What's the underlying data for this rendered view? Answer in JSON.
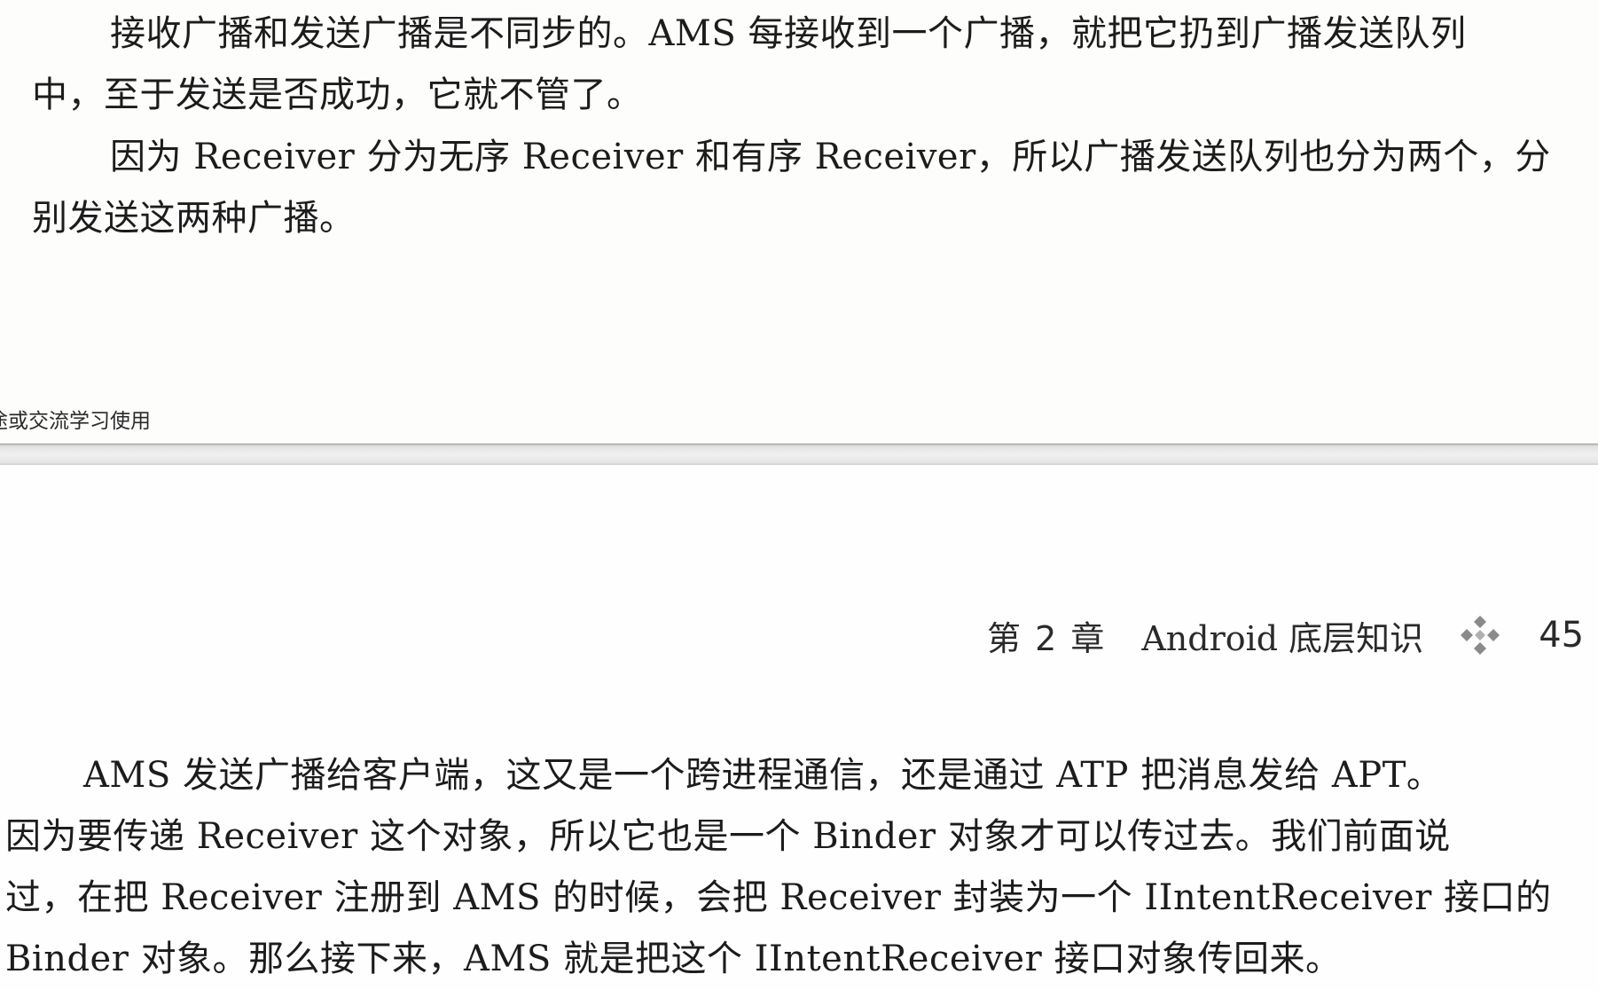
{
  "top_page": {
    "paragraph_1": {
      "line_1": "接收广播和发送广播是不同步的。AMS 每接收到一个广播，就把它扔到广播发送队列",
      "line_2": "中，至于发送是否成功，它就不管了。"
    },
    "paragraph_2": {
      "line_1": "因为 Receiver 分为无序 Receiver 和有序 Receiver，所以广播发送队列也分为两个，分",
      "line_2": "别发送这两种广播。"
    },
    "watermark": "途或交流学习使用"
  },
  "bottom_page": {
    "running_header": {
      "chapter_label": "第 2 章",
      "chapter_title": "Android 底层知识",
      "ornament_icon": "diamond-ornament-icon",
      "page_number": "45"
    },
    "paragraph_3": {
      "line_1": "AMS 发送广播给客户端，这又是一个跨进程通信，还是通过 ATP 把消息发给 APT。",
      "line_2": "因为要传递 Receiver 这个对象，所以它也是一个 Binder 对象才可以传过去。我们前面说",
      "line_3": "过，在把 Receiver 注册到 AMS 的时候，会把 Receiver 封装为一个 IIntentReceiver 接口的",
      "line_4": "Binder 对象。那么接下来，AMS 就是把这个 IIntentReceiver 接口对象传回来。"
    }
  },
  "colors": {
    "text": "#1c1c1c",
    "ornament": "#8a8a8a",
    "separator": "#e4e4e4"
  }
}
